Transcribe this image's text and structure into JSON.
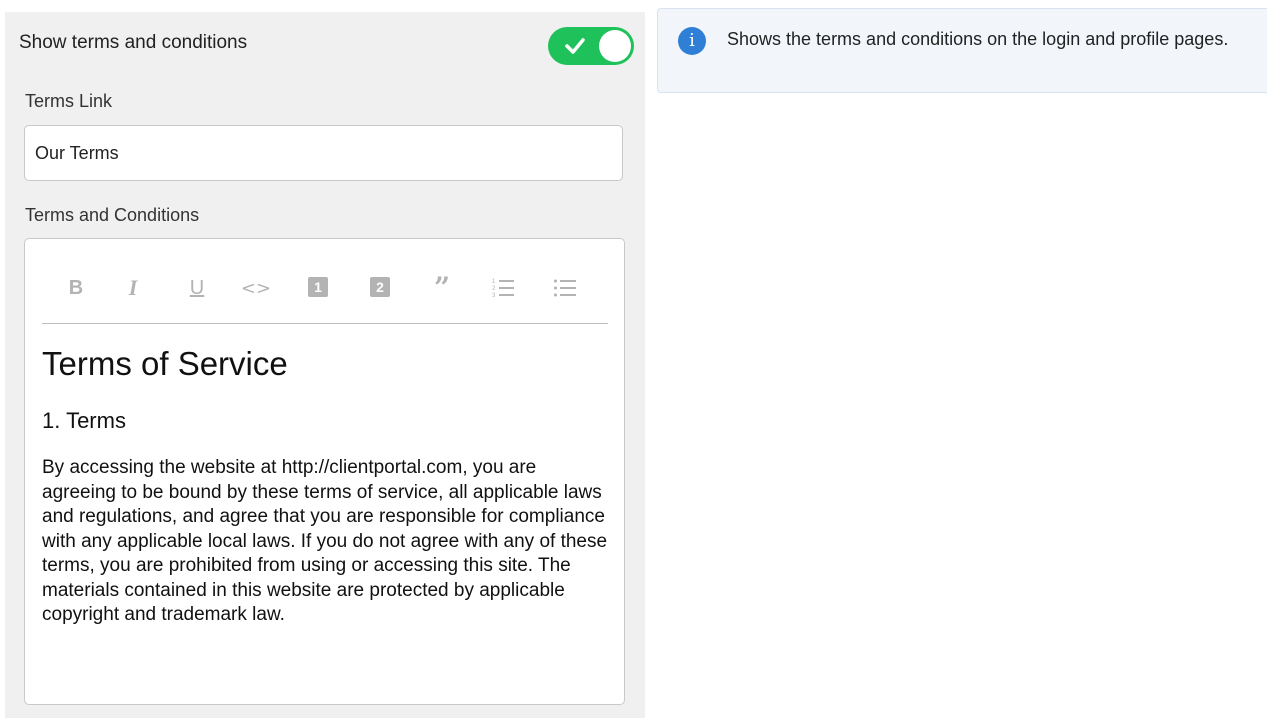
{
  "settings": {
    "show_terms": {
      "label": "Show terms and conditions",
      "enabled": true,
      "accent_color": "#1fc25a"
    },
    "terms_link": {
      "label": "Terms Link",
      "value": "Our Terms"
    },
    "terms_conditions": {
      "label": "Terms and Conditions",
      "toolbar": [
        {
          "name": "bold-icon",
          "glyph": "B"
        },
        {
          "name": "italic-icon",
          "glyph": "I"
        },
        {
          "name": "underline-icon",
          "glyph": "U"
        },
        {
          "name": "code-icon",
          "glyph": "<>"
        },
        {
          "name": "heading-1-icon",
          "glyph": "1"
        },
        {
          "name": "heading-2-icon",
          "glyph": "2"
        },
        {
          "name": "quote-icon",
          "glyph": "”"
        },
        {
          "name": "ordered-list-icon",
          "glyph": "ol"
        },
        {
          "name": "bullet-list-icon",
          "glyph": "ul"
        }
      ],
      "document": {
        "title": "Terms of Service",
        "section_heading": "1. Terms",
        "paragraph": "By accessing the website at http://clientportal.com, you are agreeing to be bound by these terms of service, all applicable laws and regulations, and agree that you are responsible for compliance with any applicable local laws. If you do not agree with any of these terms, you are prohibited from using or accessing this site. The materials contained in this website are protected by applicable copyright and trademark law."
      }
    }
  },
  "info": {
    "icon": "info-icon",
    "text": "Shows the terms and conditions on the login and profile pages.",
    "icon_color": "#2f7fd6"
  }
}
